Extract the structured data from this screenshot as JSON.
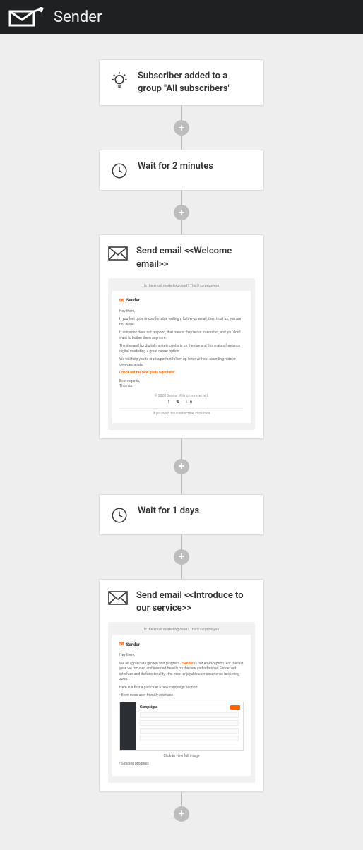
{
  "header": {
    "brand": "Sender"
  },
  "flow": {
    "trigger": {
      "title": "Subscriber added to a group \"All subscribers\""
    },
    "wait1": {
      "title": "Wait for 2 minutes"
    },
    "email1": {
      "title": "Send email <<Welcome email>>",
      "preview": {
        "subject": "Is the email marketing dead? This'll surprise you",
        "brand": "Sender",
        "p1": "Hey there,",
        "p2": "If you feel quite uncomfortable writing a follow-up email, then trust us, you are not alone.",
        "p3": "If someone does not respond, that means they're not interested, and you don't want to bother them anymore.",
        "p4": "The demand for digital marketing jobs is on the rise and this makes freelance digital marketing a great career option.",
        "p5": "We will help you to craft a perfect follow-up letter without sounding rude or over-desperate.",
        "cta": "Check out the new guide right here.",
        "signoff": "Best regards,\nThomas",
        "copyright": "© 2020 Sender. All rights reserved.",
        "unsub": "If you wish to unsubscribe, click here"
      }
    },
    "wait2": {
      "title": "Wait for 1 days"
    },
    "email2": {
      "title": "Send email <<Introduce to our service>>",
      "preview": {
        "subject": "Is the email marketing dead? This'll surprise you",
        "brand": "Sender",
        "p1": "Hey there,",
        "p2_a": "We all appreciate growth and progress - ",
        "p2_b": "Sender",
        "p2_c": " is not an exception. For the last year, we focused and invested heavily on the new and refreshed Sender.net interface and its functionality - the most enjoyable user experience is coming soon.",
        "p3": "Here is a first a glance at a new campaign section:",
        "bullet1": "• Even more user-friendly interface",
        "sc_title": "Campaigns",
        "caption": "Click to view full image",
        "bullet2": "• Sending progress"
      }
    }
  }
}
